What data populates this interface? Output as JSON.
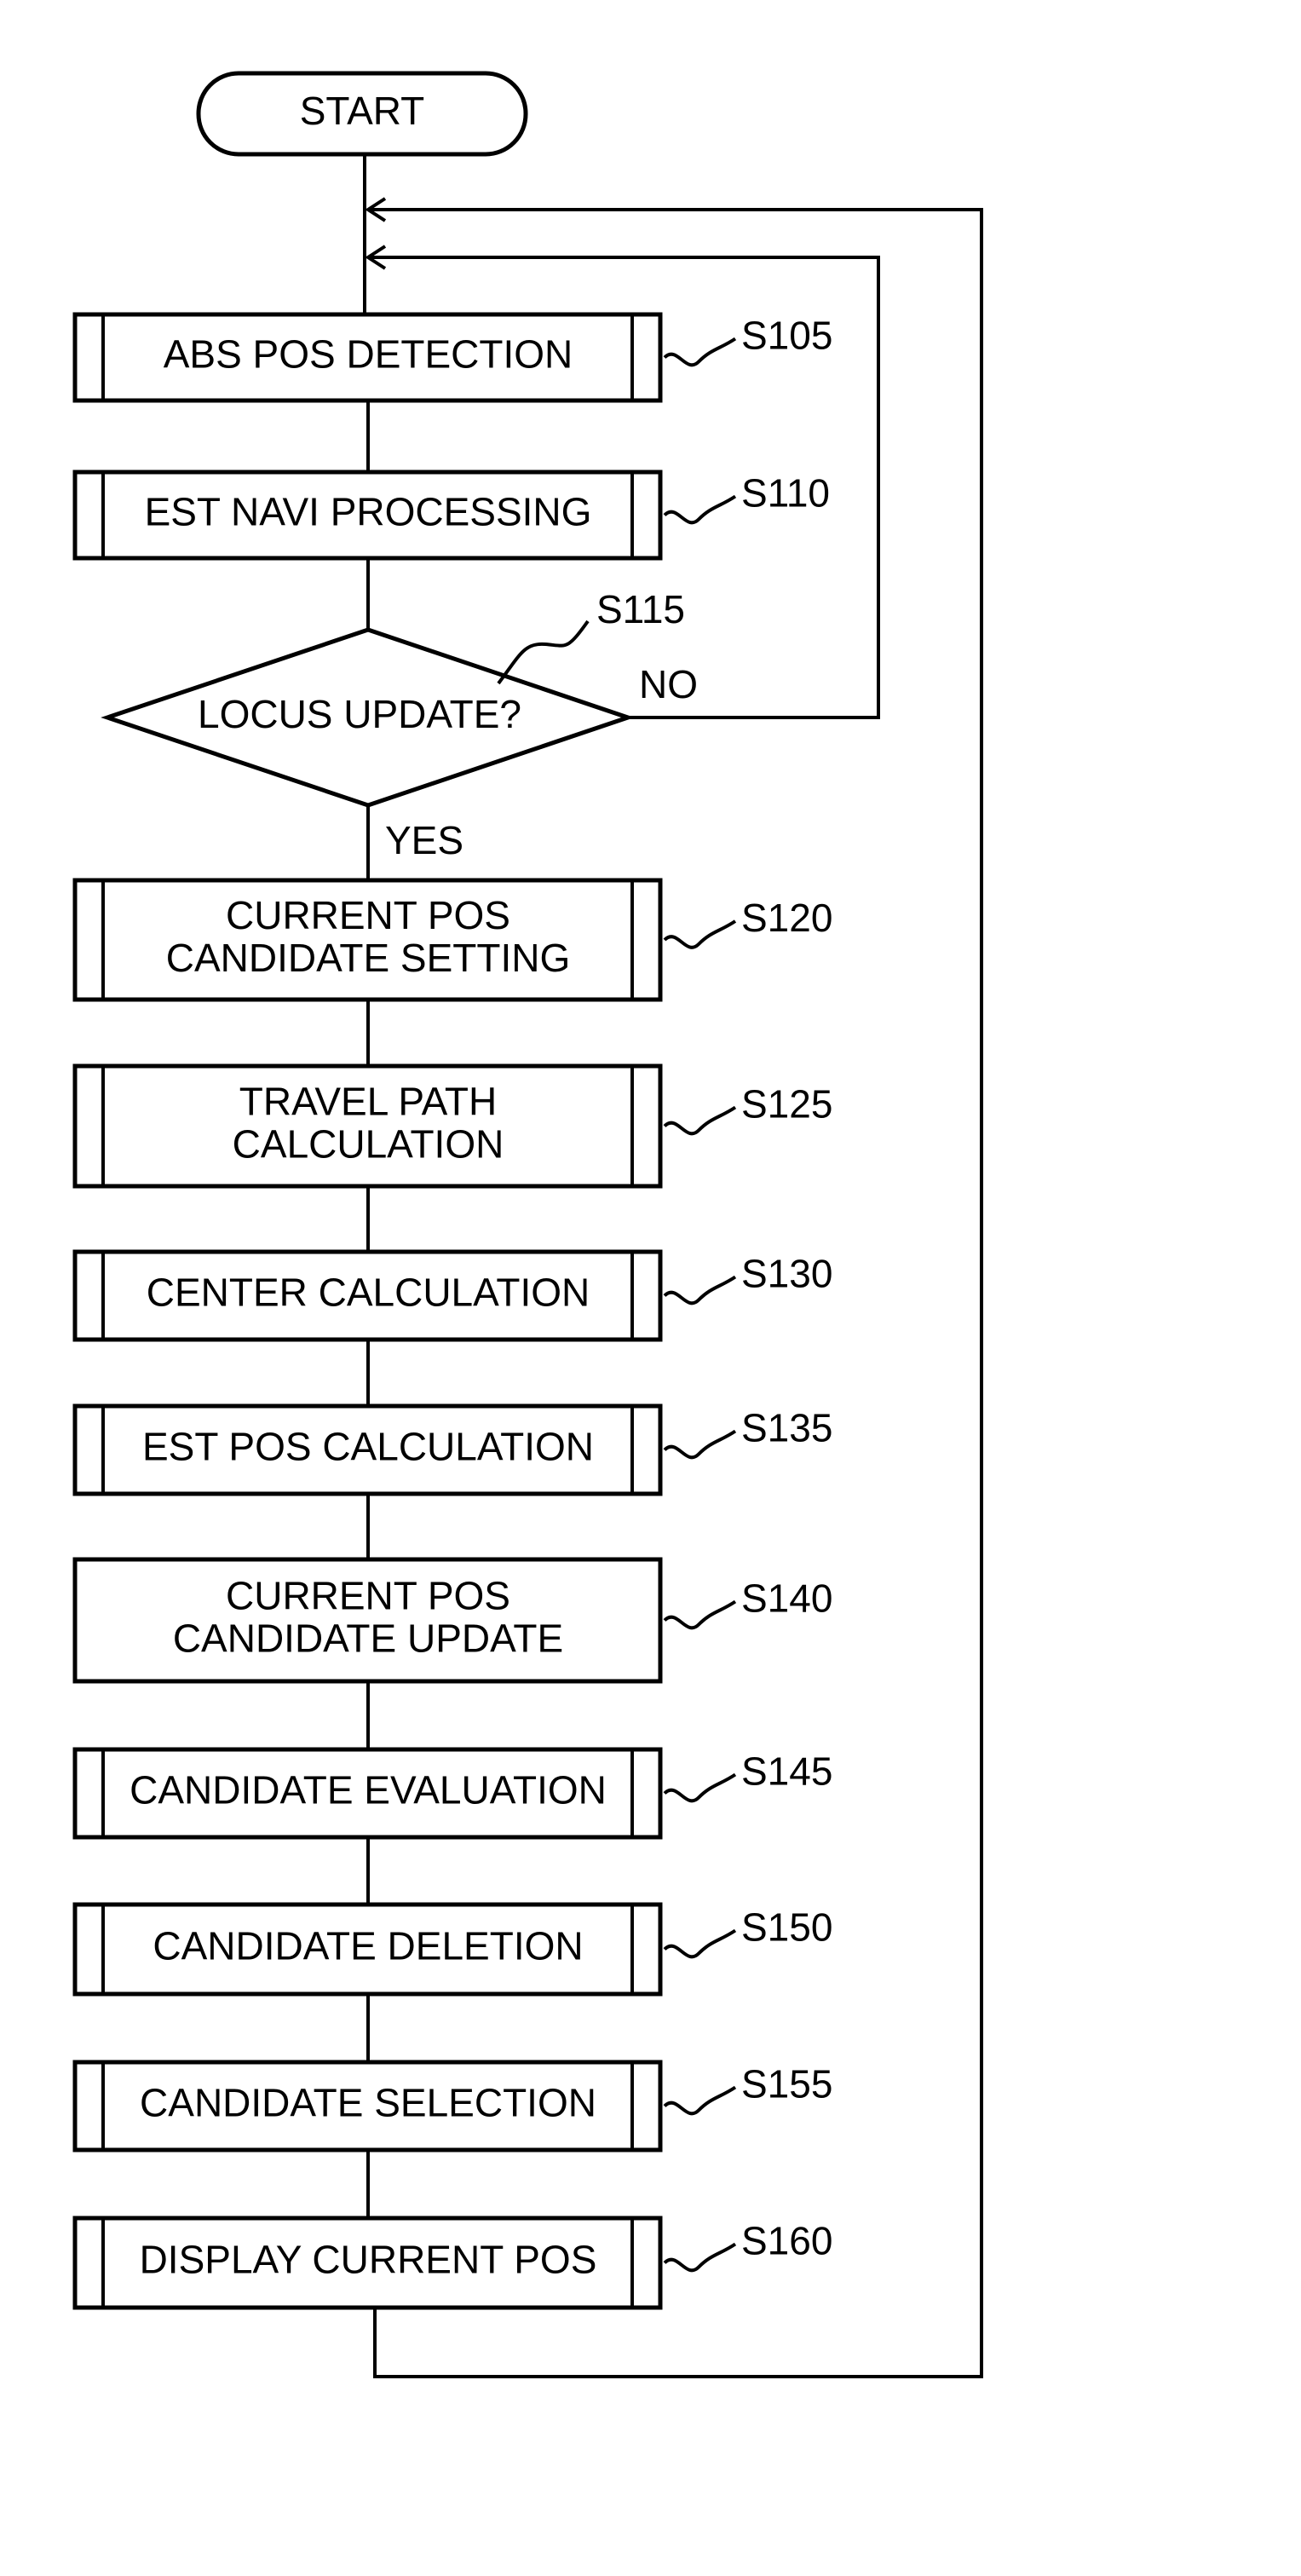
{
  "flowchart": {
    "start": {
      "label": "START"
    },
    "steps": [
      {
        "id": "S105",
        "lines": [
          "ABS POS DETECTION"
        ],
        "kind": "predefined-process"
      },
      {
        "id": "S110",
        "lines": [
          "EST NAVI PROCESSING"
        ],
        "kind": "predefined-process"
      },
      {
        "id": "S115",
        "lines": [
          "LOCUS UPDATE?"
        ],
        "kind": "decision",
        "yes_label": "YES",
        "no_label": "NO"
      },
      {
        "id": "S120",
        "lines": [
          "CURRENT POS",
          "CANDIDATE SETTING"
        ],
        "kind": "predefined-process"
      },
      {
        "id": "S125",
        "lines": [
          "TRAVEL PATH",
          "CALCULATION"
        ],
        "kind": "predefined-process"
      },
      {
        "id": "S130",
        "lines": [
          "CENTER CALCULATION"
        ],
        "kind": "predefined-process"
      },
      {
        "id": "S135",
        "lines": [
          "EST POS CALCULATION"
        ],
        "kind": "predefined-process"
      },
      {
        "id": "S140",
        "lines": [
          "CURRENT POS",
          "CANDIDATE UPDATE"
        ],
        "kind": "process"
      },
      {
        "id": "S145",
        "lines": [
          "CANDIDATE EVALUATION"
        ],
        "kind": "predefined-process"
      },
      {
        "id": "S150",
        "lines": [
          "CANDIDATE DELETION"
        ],
        "kind": "predefined-process"
      },
      {
        "id": "S155",
        "lines": [
          "CANDIDATE SELECTION"
        ],
        "kind": "predefined-process"
      },
      {
        "id": "S160",
        "lines": [
          "DISPLAY CURRENT POS"
        ],
        "kind": "predefined-process"
      }
    ],
    "loops": [
      {
        "from": "S115",
        "condition": "NO",
        "to": "before S105"
      },
      {
        "from": "S160",
        "condition": "",
        "to": "before S105"
      }
    ]
  }
}
